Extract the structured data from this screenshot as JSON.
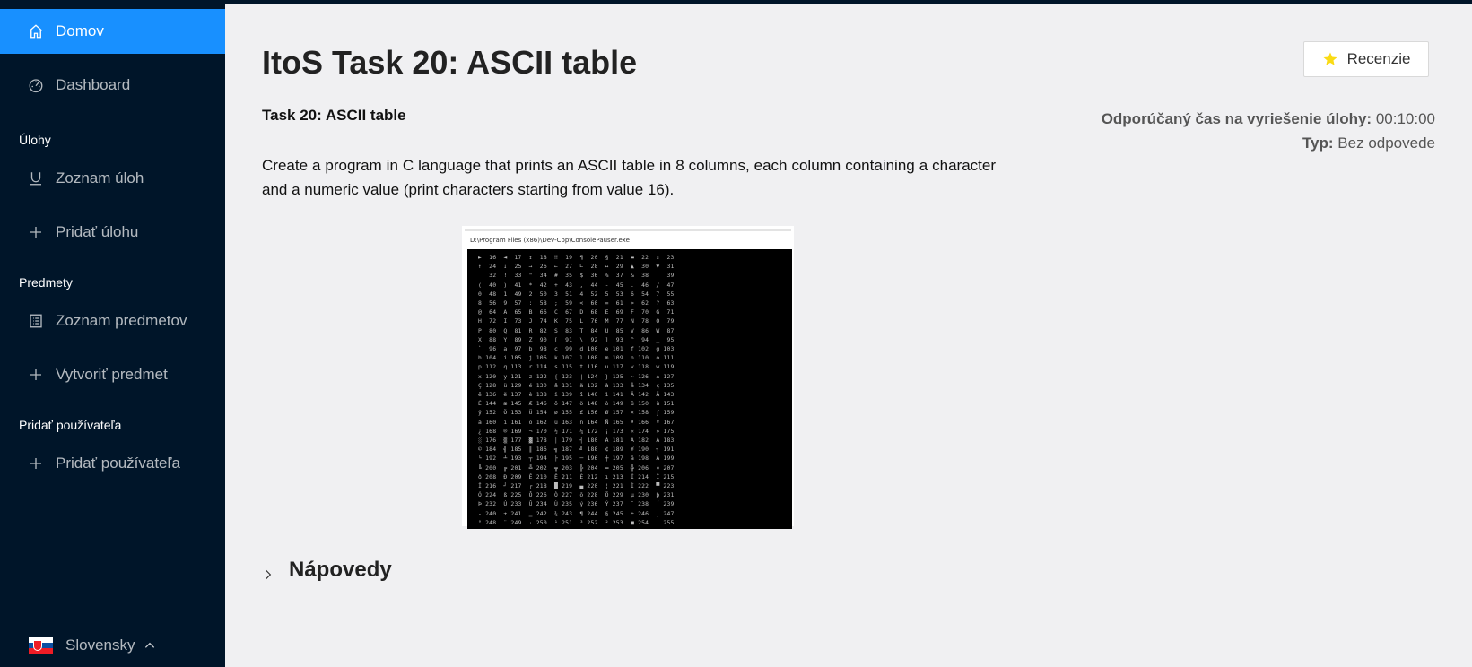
{
  "sidebar": {
    "items": [
      {
        "label": "Domov",
        "icon": "home-icon",
        "active": true
      },
      {
        "label": "Dashboard",
        "icon": "dashboard-icon"
      }
    ],
    "groups": [
      {
        "title": "Úlohy",
        "items": [
          {
            "label": "Zoznam úloh",
            "icon": "list-icon"
          },
          {
            "label": "Pridať úlohu",
            "icon": "plus-icon"
          }
        ]
      },
      {
        "title": "Predmety",
        "items": [
          {
            "label": "Zoznam predmetov",
            "icon": "list-icon"
          },
          {
            "label": "Vytvoriť predmet",
            "icon": "plus-icon"
          }
        ]
      },
      {
        "title": "Pridať používateľa",
        "items": [
          {
            "label": "Pridať používateľa",
            "icon": "plus-icon"
          }
        ]
      }
    ],
    "language": {
      "label": "Slovensky",
      "flag": "slovak-flag-icon"
    },
    "colors": {
      "background": "#001529",
      "active": "#1890ff"
    }
  },
  "main": {
    "title": "ItoS Task 20: ASCII table",
    "review_button": {
      "label": "Recenzie",
      "icon": "star-icon",
      "icon_color": "#fadb14"
    },
    "subtitle": "Task 20: ASCII table",
    "recommended_time_label": "Odporúčaný čas na vyriešenie úlohy:",
    "recommended_time_value": "00:10:00",
    "type_label": "Typ:",
    "type_value": "Bez odpovede",
    "description": "Create a program in C language that prints an ASCII table in 8 columns, each column containing a character and a numeric value (print characters starting from value 16).",
    "console": {
      "title": "D:\\Program Files (x86)\\Dev-Cpp\\ConsolePauser.exe",
      "output": "►  16  ◄  17  ↕  18  ‼  19  ¶  20  §  21  ▬  22  ↨  23\n↑  24  ↓  25  →  26  ←  27  ∟  28  ↔  29  ▲  30  ▼  31\n   32  !  33  \"  34  #  35  $  36  %  37  &  38  '  39\n(  40  )  41  *  42  +  43  ,  44  -  45  .  46  /  47\n0  48  1  49  2  50  3  51  4  52  5  53  6  54  7  55\n8  56  9  57  :  58  ;  59  <  60  =  61  >  62  ?  63\n@  64  A  65  B  66  C  67  D  68  E  69  F  70  G  71\nH  72  I  73  J  74  K  75  L  76  M  77  N  78  O  79\nP  80  Q  81  R  82  S  83  T  84  U  85  V  86  W  87\nX  88  Y  89  Z  90  [  91  \\  92  ]  93  ^  94  _  95\n`  96  a  97  b  98  c  99  d 100  e 101  f 102  g 103\nh 104  i 105  j 106  k 107  l 108  m 109  n 110  o 111\np 112  q 113  r 114  s 115  t 116  u 117  v 118  w 119\nx 120  y 121  z 122  { 123  | 124  } 125  ~ 126  ⌂ 127\nÇ 128  ü 129  é 130  â 131  ä 132  à 133  å 134  ç 135\nê 136  ë 137  è 138  ï 139  î 140  ì 141  Ä 142  Å 143\nÉ 144  æ 145  Æ 146  ô 147  ö 148  ò 149  û 150  ù 151\nÿ 152  Ö 153  Ü 154  ø 155  £ 156  Ø 157  × 158  ƒ 159\ná 160  í 161  ó 162  ú 163  ñ 164  Ñ 165  ª 166  º 167\n¿ 168  ® 169  ¬ 170  ½ 171  ¼ 172  ¡ 173  « 174  » 175\n░ 176  ▒ 177  ▓ 178  │ 179  ┤ 180  Á 181  Â 182  À 183\n© 184  ╣ 185  ║ 186  ╗ 187  ╝ 188  ¢ 189  ¥ 190  ┐ 191\n└ 192  ┴ 193  ┬ 194  ├ 195  ─ 196  ┼ 197  ã 198  Ã 199\n╚ 200  ╔ 201  ╩ 202  ╦ 203  ╠ 204  ═ 205  ╬ 206  ¤ 207\nð 208  Ð 209  Ê 210  Ë 211  È 212  ı 213  Í 214  Î 215\nÏ 216  ┘ 217  ┌ 218  █ 219  ▄ 220  ¦ 221  Ì 222  ▀ 223\nÓ 224  ß 225  Ô 226  Ò 227  õ 228  Õ 229  µ 230  þ 231\nÞ 232  Ú 233  Û 234  Ù 235  ý 236  Ý 237  ¯ 238  ´ 239\n- 240  ± 241  ‗ 242  ¾ 243  ¶ 244  § 245  ÷ 246  ¸ 247\n° 248  ¨ 249  · 250  ¹ 251  ³ 252  ² 253  ■ 254    255"
    },
    "hints": {
      "title": "Nápovedy",
      "icon": "chevron-right-icon"
    }
  }
}
